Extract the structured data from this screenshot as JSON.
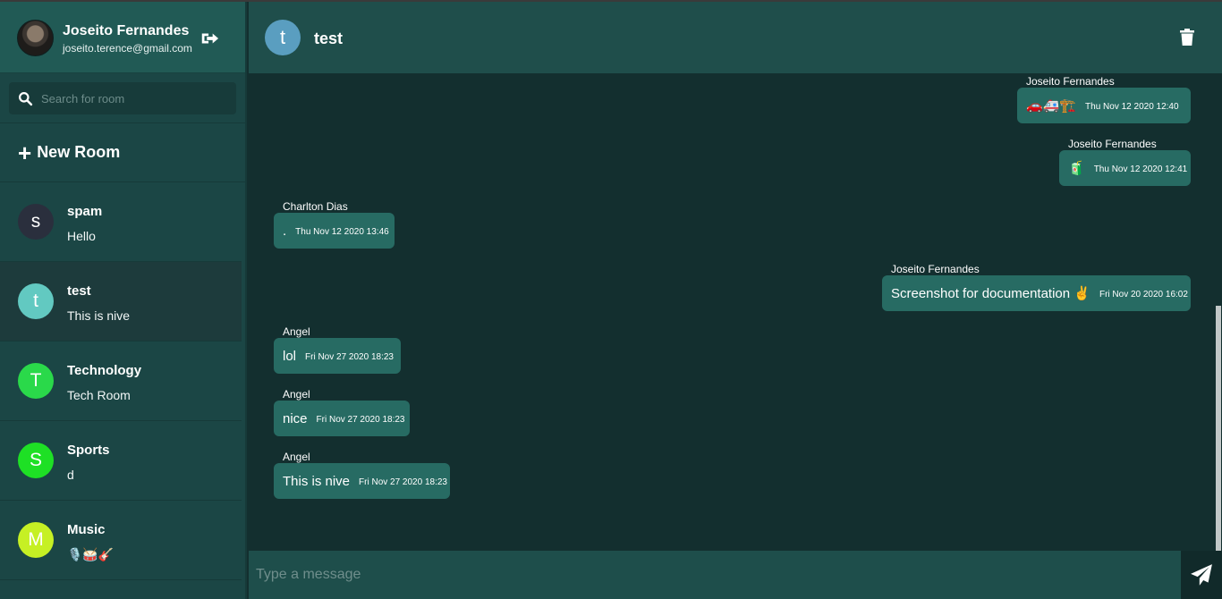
{
  "user": {
    "name": "Joseito Fernandes",
    "email": "joseito.terence@gmail.com"
  },
  "search": {
    "placeholder": "Search for room"
  },
  "new_room_label": "New Room",
  "rooms": [
    {
      "initial": "s",
      "name": "spam",
      "last": "Hello",
      "color": "#2a2f3d"
    },
    {
      "initial": "t",
      "name": "test",
      "last": "This is nive",
      "color": "#62c9c1"
    },
    {
      "initial": "T",
      "name": "Technology",
      "last": "Tech Room",
      "color": "#2ad94a"
    },
    {
      "initial": "S",
      "name": "Sports",
      "last": "d",
      "color": "#1ee025"
    },
    {
      "initial": "M",
      "name": "Music",
      "last": "🎙️🥁🎸",
      "color": "#c6f024"
    }
  ],
  "active_room": {
    "initial": "t",
    "name": "test"
  },
  "messages": [
    {
      "sender": "Joseito Fernandes",
      "text": "🚗🚑🏗️",
      "time": "Thu Nov 12 2020 12:40",
      "mine": true
    },
    {
      "sender": "Joseito Fernandes",
      "text": "🧃",
      "time": "Thu Nov 12 2020 12:41",
      "mine": true
    },
    {
      "sender": "Charlton Dias",
      "text": ".",
      "time": "Thu Nov 12 2020 13:46",
      "mine": false
    },
    {
      "sender": "Joseito Fernandes",
      "text": "Screenshot for documentation ✌️",
      "time": "Fri Nov 20 2020 16:02",
      "mine": true
    },
    {
      "sender": "Angel",
      "text": "lol",
      "time": "Fri Nov 27 2020 18:23",
      "mine": false
    },
    {
      "sender": "Angel",
      "text": "nice",
      "time": "Fri Nov 27 2020 18:23",
      "mine": false
    },
    {
      "sender": "Angel",
      "text": "This is nive",
      "time": "Fri Nov 27 2020 18:23",
      "mine": false
    }
  ],
  "composer": {
    "placeholder": "Type a message"
  },
  "icons": {
    "logout": "logout-icon",
    "search": "search-icon",
    "plus": "plus-icon",
    "trash": "trash-icon",
    "send": "send-icon"
  }
}
